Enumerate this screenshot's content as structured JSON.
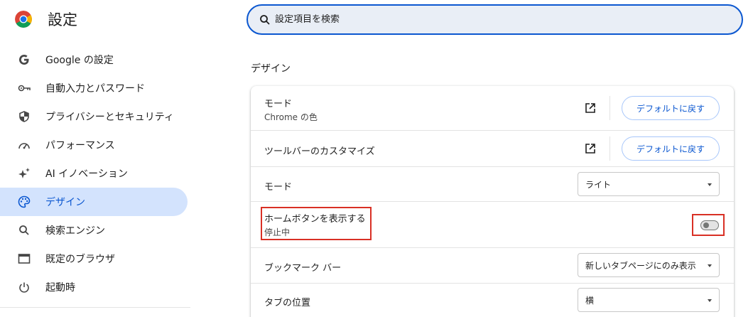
{
  "app": {
    "title": "設定"
  },
  "search": {
    "placeholder": "設定項目を検索"
  },
  "sidebar": {
    "items": [
      {
        "label": "Google の設定",
        "icon": "google-g-icon"
      },
      {
        "label": "自動入力とパスワード",
        "icon": "key-icon"
      },
      {
        "label": "プライバシーとセキュリティ",
        "icon": "shield-icon"
      },
      {
        "label": "パフォーマンス",
        "icon": "speedometer-icon"
      },
      {
        "label": "AI イノベーション",
        "icon": "sparkle-icon"
      },
      {
        "label": "デザイン",
        "icon": "palette-icon",
        "active": true
      },
      {
        "label": "検索エンジン",
        "icon": "search-icon"
      },
      {
        "label": "既定のブラウザ",
        "icon": "browser-window-icon"
      },
      {
        "label": "起動時",
        "icon": "power-icon"
      }
    ]
  },
  "main": {
    "section_title": "デザイン",
    "rows": {
      "mode_theme": {
        "label": "モード",
        "sub": "Chrome の色",
        "button": "デフォルトに戻す"
      },
      "toolbar": {
        "label": "ツールバーのカスタマイズ",
        "button": "デフォルトに戻す"
      },
      "mode": {
        "label": "モード",
        "value": "ライト"
      },
      "home_button": {
        "label": "ホームボタンを表示する",
        "sub": "停止中",
        "enabled": false
      },
      "bookmark_bar": {
        "label": "ブックマーク バー",
        "value": "新しいタブページにのみ表示"
      },
      "tab_position": {
        "label": "タブの位置",
        "value": "横"
      }
    }
  },
  "colors": {
    "accent": "#0b57d0",
    "active_bg": "#d3e3fd",
    "highlight": "#d93025"
  }
}
